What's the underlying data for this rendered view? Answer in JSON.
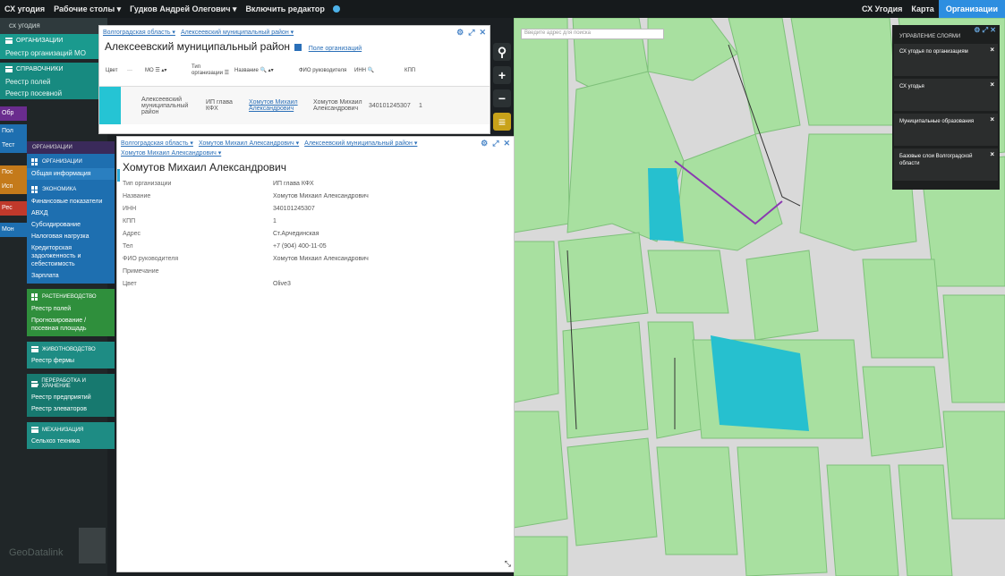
{
  "topbar": {
    "items": [
      "СХ угодия",
      "Рабочие столы ▾",
      "Гудков Андрей Олегович ▾",
      "Включить редактор"
    ],
    "right": [
      "СХ Угодия",
      "Карта",
      "Организации"
    ]
  },
  "leftbar": {
    "top_label": "сх угодия",
    "groups": [
      {
        "head": "организации",
        "items": [
          "Реестр организаций МО"
        ]
      },
      {
        "head": "справочники",
        "items": [
          "Реестр полей",
          "Реестр посевной"
        ]
      }
    ],
    "partial_labels": [
      "Обр",
      "Пол",
      "Тест",
      "Пос",
      "Исп",
      "Рес",
      "Мон"
    ]
  },
  "subnav": {
    "header": "организации",
    "blocks": [
      {
        "head": "организации",
        "items": [
          "Общая информация"
        ]
      },
      {
        "head": "экономика",
        "items": [
          "Финансовые показатели",
          "АВХД",
          "Субсидирование",
          "Налоговая нагрузка",
          "Кредиторская задолженность и себестоимость",
          "Зарплата"
        ]
      },
      {
        "head": "растениеводство",
        "items": [
          "Реестр полей",
          "Прогнозирование / посевная площадь"
        ]
      },
      {
        "head": "животноводство",
        "items": [
          "Реестр фермы"
        ]
      },
      {
        "head": "переработка и хранение",
        "items": [
          "Реестр предприятий",
          "Реестр элеваторов"
        ]
      },
      {
        "head": "механизация",
        "items": [
          "Сельхоз техника"
        ]
      }
    ]
  },
  "win1": {
    "breadcrumb": [
      "Волгоградская область ▾",
      "Алексеевский муниципальный район ▾"
    ],
    "title": "Алексеевский муниципальный район",
    "legend_link": "Поле организаций",
    "columns": [
      "Цвет",
      "···",
      "МО ☰ ▴▾",
      "Тип организации ☰",
      "Название 🔍 ▴▾",
      "ФИО руководителя",
      "ИНН 🔍",
      "КПП"
    ],
    "row": {
      "mo": "Алексеевский муниципальный район",
      "type": "ИП глава КФХ",
      "name": "Хомутов Михаил Александрович",
      "fio": "Хомутов Михаил Александрович",
      "inn": "340101245307",
      "kpp": "1"
    }
  },
  "win2": {
    "breadcrumb": [
      "Волгоградская область ▾",
      "Хомутов Михаил Александрович ▾",
      "Алексеевский муниципальный район ▾"
    ],
    "sub_breadcrumb": "Хомутов Михаил Александрович ▾",
    "title": "Хомутов Михаил Александрович",
    "props": [
      {
        "k": "Тип организации",
        "v": "ИП глава КФХ"
      },
      {
        "k": "Название",
        "v": "Хомутов Михаил Александрович"
      },
      {
        "k": "ИНН",
        "v": "340101245307"
      },
      {
        "k": "КПП",
        "v": "1"
      },
      {
        "k": "Адрес",
        "v": "Ст.Арчединская"
      },
      {
        "k": "Тел",
        "v": "+7 (904) 400-11-05"
      },
      {
        "k": "ФИО руководителя",
        "v": "Хомутов Михаил Александрович"
      },
      {
        "k": "Примечание",
        "v": ""
      },
      {
        "k": "Цвет",
        "v": "Olive3"
      }
    ]
  },
  "map": {
    "search_placeholder": "Введите адрес для поиска"
  },
  "layers": {
    "header": "управление слоями",
    "items": [
      "СХ угодья по организациям",
      "СХ угодья",
      "Муниципальные образования",
      "Базовые слои Волгоградской области"
    ]
  },
  "watermark": "GeoDatalink",
  "colors": {
    "field_green": "#a8e0a0",
    "field_cyan": "#26c0cf",
    "accent_blue": "#2d8ee0",
    "teal": "#1a9a8e"
  }
}
